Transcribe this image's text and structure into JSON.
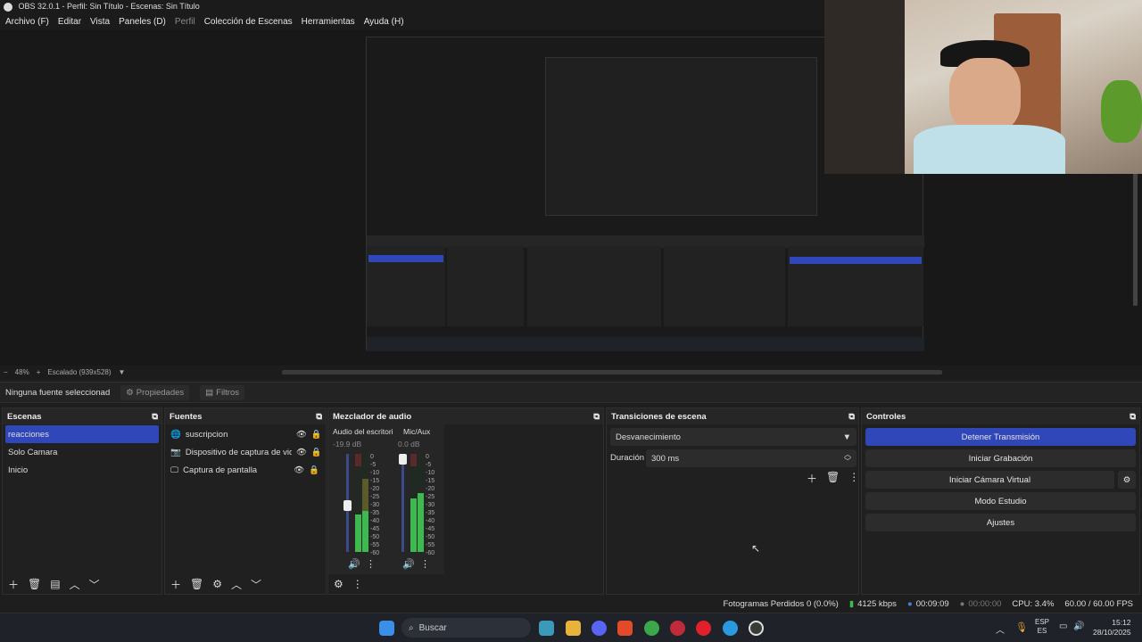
{
  "window": {
    "title": "OBS 32.0.1 - Perfil: Sin Título - Escenas: Sin Título"
  },
  "menu": [
    {
      "label": "Archivo (F)"
    },
    {
      "label": "Editar"
    },
    {
      "label": "Vista"
    },
    {
      "label": "Paneles (D)"
    },
    {
      "label": "Perfil"
    },
    {
      "label": "Colección de Escenas"
    },
    {
      "label": "Herramientas"
    },
    {
      "label": "Ayuda (H)"
    }
  ],
  "preview": {
    "zoom": "48%",
    "scale_mode": "Escalado (939x528)"
  },
  "source_toolbar": {
    "selected": "Ninguna fuente seleccionad",
    "properties": "Propiedades",
    "filters": "Filtros"
  },
  "scenes": {
    "title": "Escenas",
    "items": [
      "reacciones",
      "Solo Camara",
      "Inicio"
    ]
  },
  "sources": {
    "title": "Fuentes",
    "items": [
      {
        "name": "suscripcion",
        "icon": "globe-icon"
      },
      {
        "name": "Dispositivo de captura de vide",
        "icon": "camera-icon"
      },
      {
        "name": "Captura de pantalla",
        "icon": "monitor-icon"
      }
    ]
  },
  "mixer": {
    "title": "Mezclador de audio",
    "channels": [
      {
        "name": "Audio del escritori",
        "db": "-19.9 dB",
        "level": 0.55
      },
      {
        "name": "Mic/Aux",
        "db": "0.0 dB",
        "level": 0.7
      }
    ],
    "scale": [
      "0",
      "-5",
      "-10",
      "-15",
      "-20",
      "-25",
      "-30",
      "-35",
      "-40",
      "-45",
      "-50",
      "-55",
      "-60"
    ]
  },
  "transitions": {
    "title": "Transiciones de escena",
    "selected": "Desvanecimiento",
    "duration_label": "Duración",
    "duration_value": "300 ms"
  },
  "controls": {
    "title": "Controles",
    "stop_stream": "Detener Transmisión",
    "start_recording": "Iniciar Grabación",
    "virtual_cam": "Iniciar Cámara Virtual",
    "studio_mode": "Modo Estudio",
    "settings": "Ajustes"
  },
  "status": {
    "dropped": "Fotogramas Perdidos 0 (0.0%)",
    "bitrate": "4125 kbps",
    "stream_time": "00:09:09",
    "rec_time": "00:00:00",
    "cpu": "CPU: 3.4%",
    "fps": "60.00 / 60.00 FPS"
  },
  "taskbar": {
    "search": "Buscar",
    "lang": "ESP",
    "lang2": "ES",
    "time": "15:12",
    "date": "28/10/2025"
  },
  "colors": {
    "accent": "#2f47b8",
    "meter_green": "#3db94f",
    "meter_yellow": "#c5b43a",
    "meter_red": "#c53a3a"
  }
}
